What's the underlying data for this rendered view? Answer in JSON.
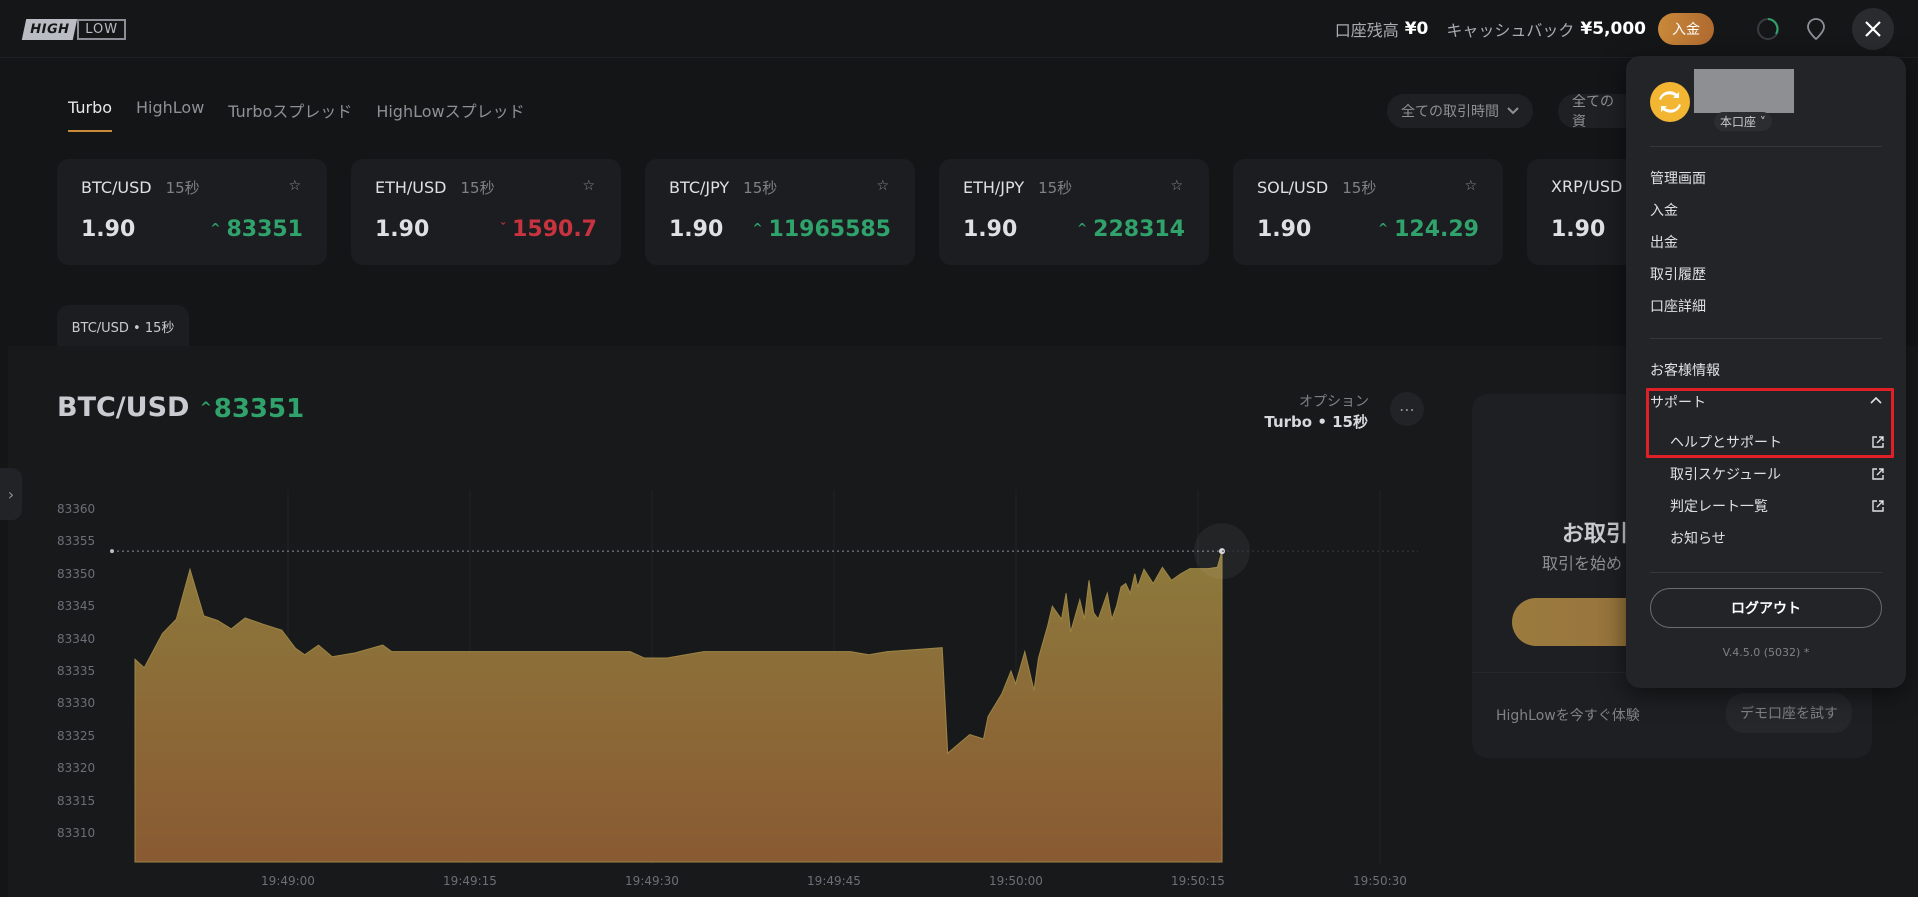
{
  "header": {
    "logo_high": "HIGH",
    "logo_low": "LOW",
    "balance_label": "口座残高",
    "balance_value": "¥0",
    "cashback_label": "キャッシュバック",
    "cashback_value": "¥5,000",
    "deposit_button": "入金",
    "close_icon": "close-icon",
    "timer_icon": "timer-icon",
    "location_icon": "location-icon"
  },
  "tabs": [
    {
      "label": "Turbo",
      "active": true
    },
    {
      "label": "HighLow",
      "active": false
    },
    {
      "label": "Turboスプレッド",
      "active": false
    },
    {
      "label": "HighLowスプレッド",
      "active": false
    }
  ],
  "filters": {
    "trade_time": "全ての取引時間",
    "assets": "全ての資"
  },
  "cards": [
    {
      "pair": "BTC/USD",
      "duration": "15秒",
      "payout": "1.90",
      "price": "83351",
      "direction": "up"
    },
    {
      "pair": "ETH/USD",
      "duration": "15秒",
      "payout": "1.90",
      "price": "1590.7",
      "direction": "down"
    },
    {
      "pair": "BTC/JPY",
      "duration": "15秒",
      "payout": "1.90",
      "price": "11965585",
      "direction": "up"
    },
    {
      "pair": "ETH/JPY",
      "duration": "15秒",
      "payout": "1.90",
      "price": "228314",
      "direction": "up"
    },
    {
      "pair": "SOL/USD",
      "duration": "15秒",
      "payout": "1.90",
      "price": "124.29",
      "direction": "up"
    },
    {
      "pair": "XRP/USD",
      "duration": "",
      "payout": "1.90",
      "price": "",
      "direction": "up"
    }
  ],
  "chart": {
    "tab_label": "BTC/USD • 15秒",
    "title": "BTC/USD",
    "price": "83351",
    "option_label": "オプション",
    "option_value": "Turbo • 15秒",
    "y_labels": [
      "83360",
      "83355",
      "83350",
      "83345",
      "83340",
      "83335",
      "83330",
      "83325",
      "83320",
      "83315",
      "83310"
    ],
    "x_labels": [
      "19:49:00",
      "19:49:15",
      "19:49:30",
      "19:49:45",
      "19:50:00",
      "19:50:15",
      "19:50:30"
    ],
    "strike_level": 83353.5,
    "area_color_top": "#8d7a3c",
    "area_color_bottom": "#8a5a32"
  },
  "trade_panel": {
    "title": "お取引",
    "subtitle": "取引を始め",
    "try_text": "HighLowを今すぐ体験",
    "demo_button": "デモ口座を試す"
  },
  "menu": {
    "account_type": "本口座",
    "items": [
      "管理画面",
      "入金",
      "出金",
      "取引履歴",
      "口座詳細"
    ],
    "customer_info": "お客様情報",
    "support": "サポート",
    "support_items": [
      {
        "label": "ヘルプとサポート",
        "external": true
      },
      {
        "label": "取引スケジュール",
        "external": true
      },
      {
        "label": "判定レート一覧",
        "external": true
      },
      {
        "label": "お知らせ",
        "external": false
      }
    ],
    "logout": "ログアウト",
    "version": "V.4.5.0 (5032) *"
  },
  "colors": {
    "up": "#2fa36b",
    "down": "#c7343f",
    "accent": "#c98a3a",
    "highlight_box": "#e02027"
  }
}
